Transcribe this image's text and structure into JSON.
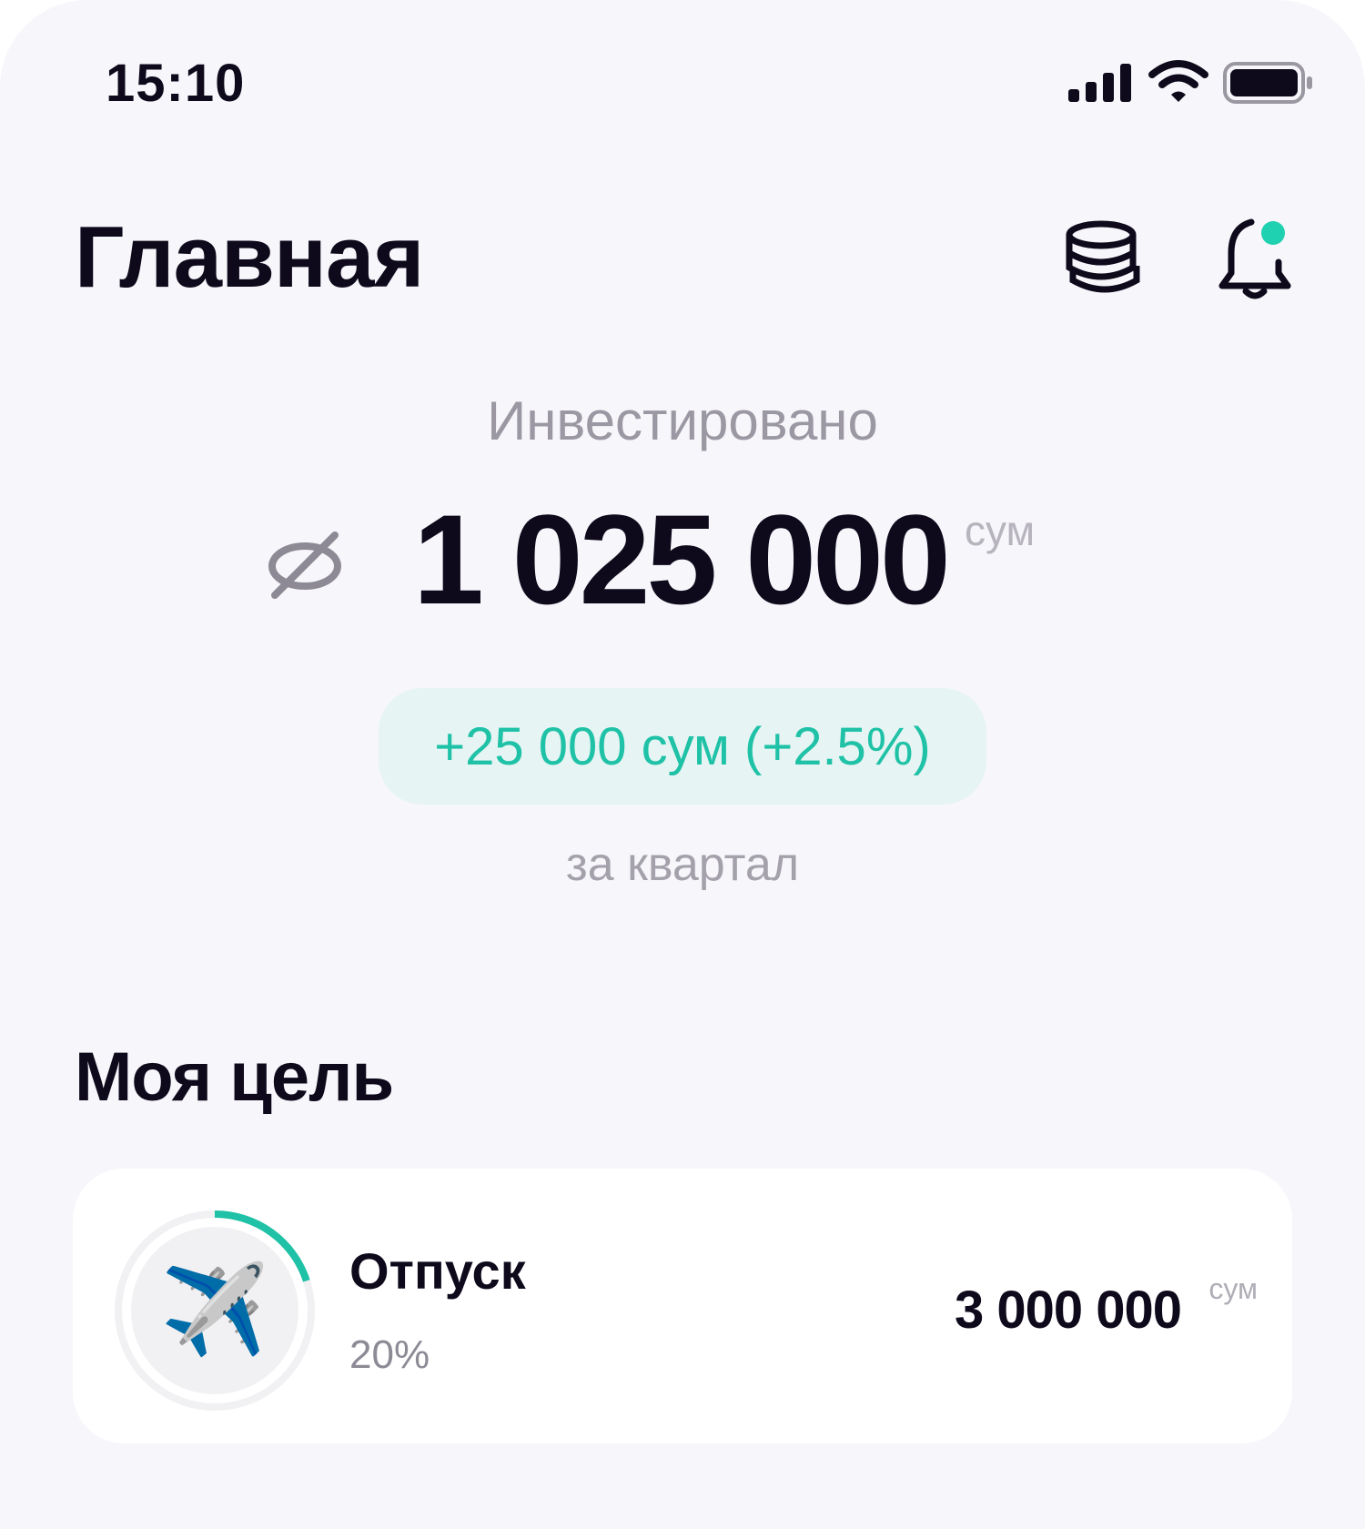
{
  "status_bar": {
    "time": "15:10",
    "icons": [
      "signal-icon",
      "wifi-icon",
      "battery-icon"
    ]
  },
  "header": {
    "title": "Главная",
    "icons": [
      "coins-icon",
      "bell-icon"
    ],
    "notification_dot_color": "#1fd1b0"
  },
  "balance": {
    "label": "Инвестировано",
    "amount": "1 025 000",
    "currency": "сум",
    "change": "+25 000 сум (+2.5%)",
    "period": "за квартал",
    "accent_color": "#1fc2a6",
    "visibility_icon": "eye-off-icon"
  },
  "goal_section": {
    "title": "Моя цель",
    "goal": {
      "emoji": "✈️",
      "name": "Отпуск",
      "percent_label": "20%",
      "progress": 0.2,
      "target_amount": "3 000 000",
      "currency": "сум",
      "ring_color": "#1fc2a6"
    }
  }
}
